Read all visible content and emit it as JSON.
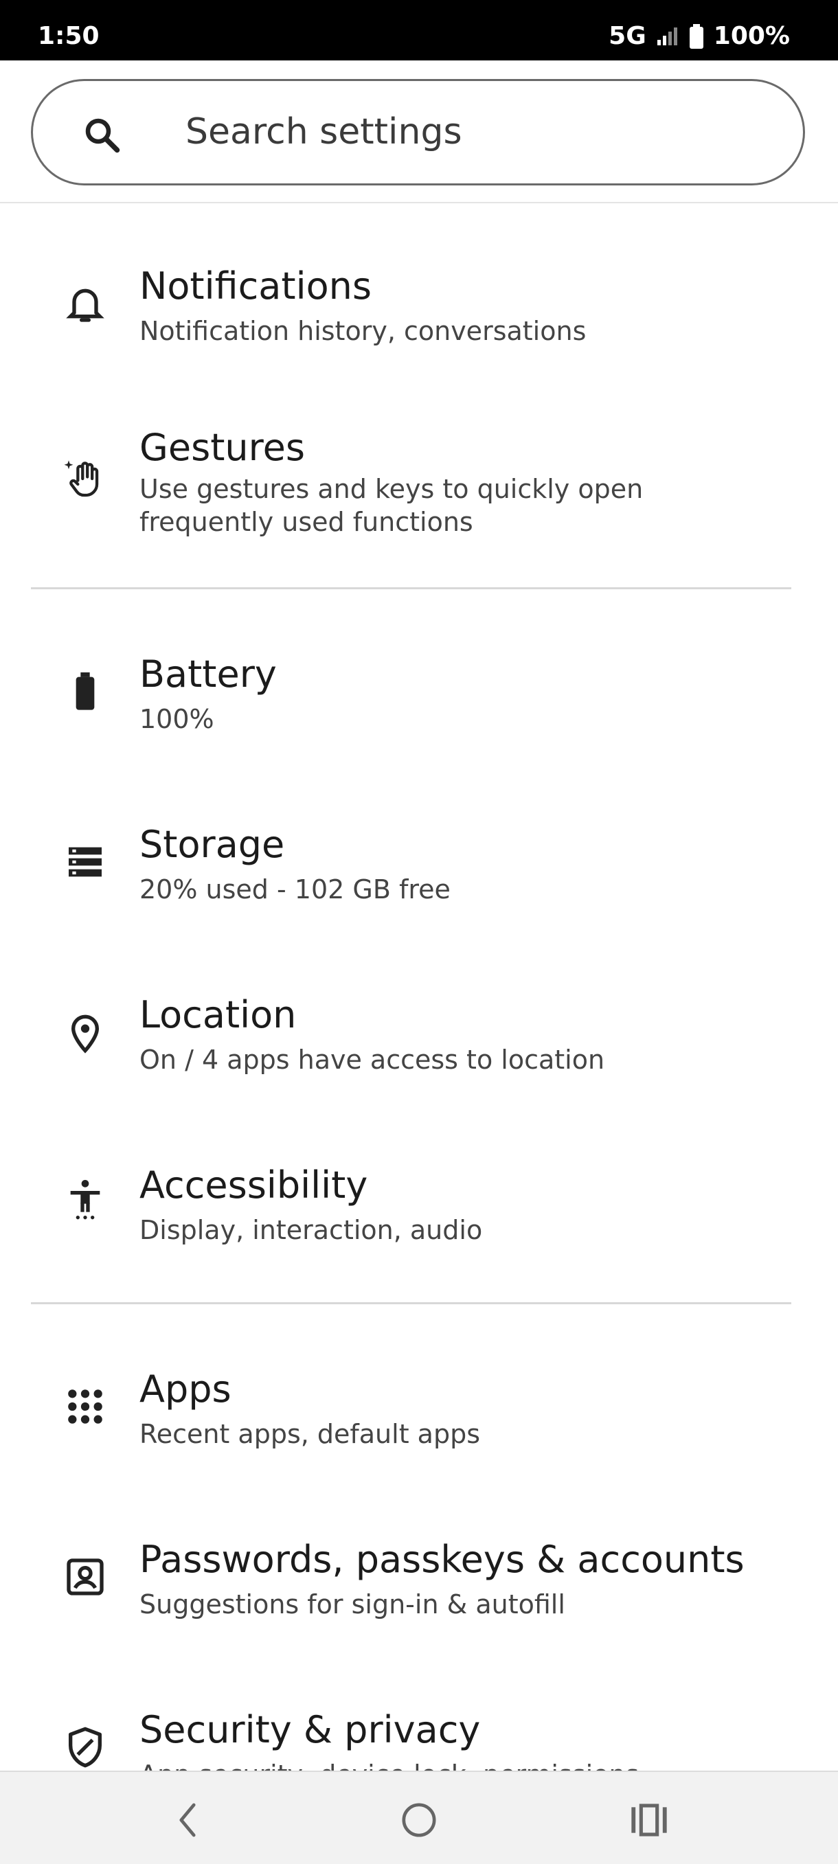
{
  "status_bar": {
    "time": "1:50",
    "network": "5G",
    "battery": "100%"
  },
  "search": {
    "placeholder": "Search settings"
  },
  "items": [
    {
      "title": "Notifications",
      "subtitle": "Notification history, conversations",
      "icon": "bell-icon"
    },
    {
      "title": "Gestures",
      "subtitle": "Use gestures and keys to quickly open frequently used functions",
      "icon": "gesture-hand-icon"
    },
    {
      "title": "Battery",
      "subtitle": "100%",
      "icon": "battery-icon"
    },
    {
      "title": "Storage",
      "subtitle": "20% used - 102 GB free",
      "icon": "storage-icon"
    },
    {
      "title": "Location",
      "subtitle": "On / 4 apps have access to location",
      "icon": "location-pin-icon"
    },
    {
      "title": "Accessibility",
      "subtitle": "Display, interaction, audio",
      "icon": "accessibility-icon"
    },
    {
      "title": "Apps",
      "subtitle": "Recent apps, default apps",
      "icon": "apps-grid-icon"
    },
    {
      "title": "Passwords, passkeys & accounts",
      "subtitle": "Suggestions for sign-in & autofill",
      "icon": "account-box-icon"
    },
    {
      "title": "Security & privacy",
      "subtitle": "App security, device lock, permissions",
      "icon": "shield-icon"
    }
  ],
  "nav": {
    "back": "back-icon",
    "home": "home-icon",
    "recents": "recents-icon"
  }
}
